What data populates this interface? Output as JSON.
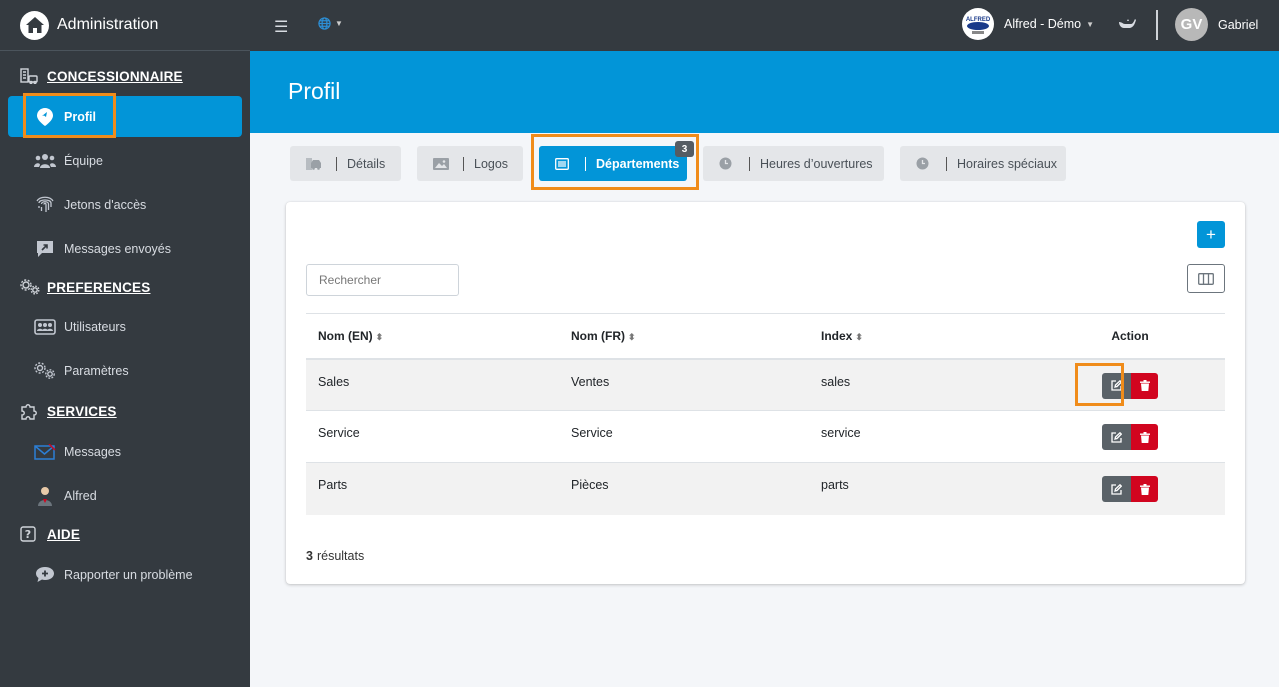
{
  "brand": {
    "title": "Administration"
  },
  "sidebar": {
    "sections": [
      {
        "label": "CONCESSIONNAIRE",
        "icon": "dealership-icon"
      },
      {
        "label": "PREFERENCES",
        "icon": "gears-icon"
      },
      {
        "label": "SERVICES",
        "icon": "puzzle-icon"
      },
      {
        "label": "AIDE",
        "icon": "question-square-icon"
      }
    ],
    "items": [
      {
        "label": "Profil",
        "icon": "map-pin-icon",
        "active": true
      },
      {
        "label": "Équipe",
        "icon": "team-icon"
      },
      {
        "label": "Jetons d'accès",
        "icon": "fingerprint-icon"
      },
      {
        "label": "Messages envoyés",
        "icon": "sent-message-icon"
      },
      {
        "label": "Utilisateurs",
        "icon": "users-card-icon"
      },
      {
        "label": "Paramètres",
        "icon": "settings-icon"
      },
      {
        "label": "Messages",
        "icon": "envelope-icon"
      },
      {
        "label": "Alfred",
        "icon": "butler-icon"
      },
      {
        "label": "Rapporter un problème",
        "icon": "report-comment-icon"
      }
    ]
  },
  "topbar": {
    "dealer_name": "Alfred - Démo",
    "user_initials": "GV",
    "user_name": "Gabriel"
  },
  "page": {
    "title": "Profil"
  },
  "tabs": [
    {
      "label": "Détails",
      "icon": "car-icon"
    },
    {
      "label": "Logos",
      "icon": "image-icon"
    },
    {
      "label": "Départements",
      "icon": "list-icon",
      "active": true,
      "badge": "3"
    },
    {
      "label": "Heures d’ouvertures",
      "icon": "clock-icon"
    },
    {
      "label": "Horaires spéciaux",
      "icon": "clock-icon"
    }
  ],
  "table": {
    "search_placeholder": "Rechercher",
    "add_label": "+",
    "columns": [
      "Nom (EN)",
      "Nom (FR)",
      "Index",
      "Action"
    ],
    "rows": [
      {
        "name_en": "Sales",
        "name_fr": "Ventes",
        "index": "sales"
      },
      {
        "name_en": "Service",
        "name_fr": "Service",
        "index": "service"
      },
      {
        "name_en": "Parts",
        "name_fr": "Pièces",
        "index": "parts"
      }
    ],
    "results_count": "3",
    "results_label": "résultats"
  },
  "colors": {
    "primary": "#0295d8",
    "sidebar_bg": "#343a40",
    "danger": "#d1051f",
    "highlight": "#f08c1a"
  }
}
